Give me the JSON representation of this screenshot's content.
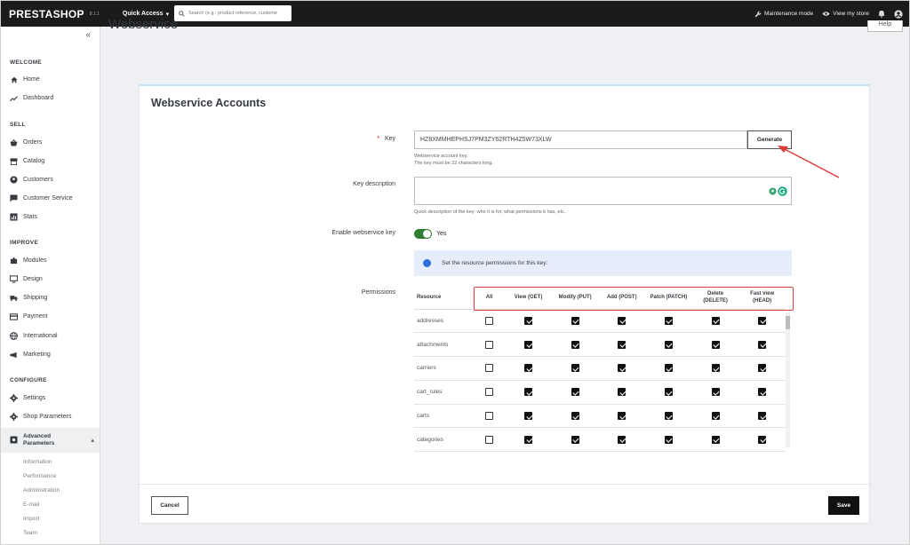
{
  "header": {
    "logo": "PRESTASHOP",
    "version": "8.1.1",
    "quick_access": "Quick Access",
    "search_placeholder": "Search (e.g.: product reference, custome",
    "maintenance": "Maintenance mode",
    "view_store": "View my store"
  },
  "sidebar": {
    "sections": {
      "welcome": "WELCOME",
      "sell": "SELL",
      "improve": "IMPROVE",
      "configure": "CONFIGURE"
    },
    "items": {
      "home": "Home",
      "dashboard": "Dashboard",
      "orders": "Orders",
      "catalog": "Catalog",
      "customers": "Customers",
      "customer_service": "Customer Service",
      "stats": "Stats",
      "modules": "Modules",
      "design": "Design",
      "shipping": "Shipping",
      "payment": "Payment",
      "international": "International",
      "marketing": "Marketing",
      "settings": "Settings",
      "shop_parameters": "Shop Parameters",
      "advanced_parameters_1": "Advanced",
      "advanced_parameters_2": "Parameters"
    },
    "submenu": {
      "information": "Information",
      "performance": "Performance",
      "administration": "Administration",
      "email": "E-mail",
      "import": "Import",
      "team": "Team"
    }
  },
  "page": {
    "title": "Webservice",
    "help": "Help"
  },
  "form": {
    "card_title": "Webservice Accounts",
    "key_label": "Key",
    "key_required": "*",
    "key_value": "HZ8XMMHEPHSJ7PM3ZY62RTH4Z5W73XLW",
    "key_help_1": "Webservice account key.",
    "key_help_2": "The key must be 32 characters long.",
    "generate": "Generate",
    "desc_label": "Key description",
    "desc_value": "",
    "desc_help": "Quick description of the key: who it is for, what permissions it has, etc.",
    "enable_label": "Enable webservice key",
    "enable_value": "Yes",
    "info_text": "Set the resource permissions for this key:",
    "permissions_label": "Permissions",
    "cancel": "Cancel",
    "save": "Save"
  },
  "permissions": {
    "headers": {
      "resource": "Resource",
      "all": "All",
      "get": "View (GET)",
      "put": "Modify (PUT)",
      "post": "Add (POST)",
      "patch": "Patch (PATCH)",
      "delete_1": "Delete",
      "delete_2": "(DELETE)",
      "head_1": "Fast view",
      "head_2": "(HEAD)"
    },
    "rows": [
      {
        "resource": "addresses",
        "all": false,
        "get": true,
        "put": true,
        "post": true,
        "patch": true,
        "delete": true,
        "head": true
      },
      {
        "resource": "attachments",
        "all": false,
        "get": true,
        "put": true,
        "post": true,
        "patch": true,
        "delete": true,
        "head": true
      },
      {
        "resource": "carriers",
        "all": false,
        "get": true,
        "put": true,
        "post": true,
        "patch": true,
        "delete": true,
        "head": true
      },
      {
        "resource": "cart_rules",
        "all": false,
        "get": true,
        "put": true,
        "post": true,
        "patch": true,
        "delete": true,
        "head": true
      },
      {
        "resource": "carts",
        "all": false,
        "get": true,
        "put": true,
        "post": true,
        "patch": true,
        "delete": true,
        "head": true
      },
      {
        "resource": "categories",
        "all": false,
        "get": true,
        "put": true,
        "post": true,
        "patch": true,
        "delete": true,
        "head": true
      }
    ]
  },
  "colors": {
    "topbar": "#1b1b1b",
    "toggle_on": "#2e7d32",
    "annotation": "#e03a3a",
    "info_bg": "#e6eefb"
  }
}
